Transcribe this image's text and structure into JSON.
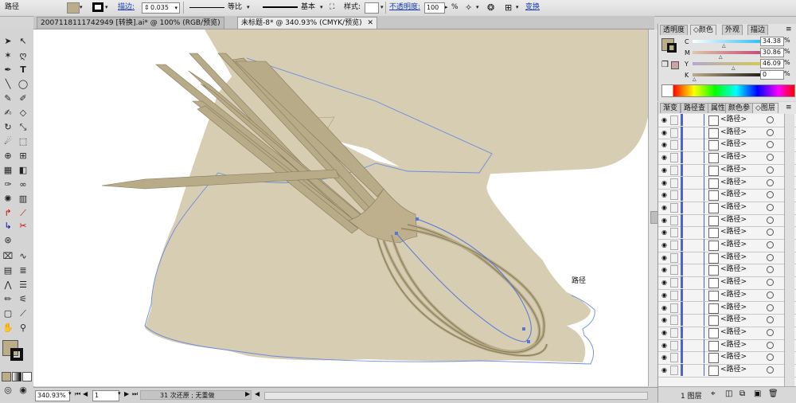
{
  "control_bar": {
    "object_type": "路径",
    "stroke_label": "描边:",
    "stroke_value": "0.035",
    "profile_uniform": "等比",
    "brush_basic": "基本",
    "style_label": "样式:",
    "opacity_label": "不透明度:",
    "opacity_value": "100",
    "percent": "%",
    "transform_label": "变换",
    "fill_color": "#b9ad8a"
  },
  "doc_tabs": [
    {
      "label": "20071181117429​49 [转换].ai* @ 100% (RGB/预览)"
    },
    {
      "label": "未标题-8* @ 340.93% (CMYK/预览)"
    }
  ],
  "canvas": {
    "path_label": "路径",
    "bg_color": "#d6cdb2",
    "whisk_color": "#b8ab88",
    "whisk_stroke": "#857a5a",
    "path_color": "#5577d9"
  },
  "status": {
    "zoom": "340.93%",
    "page": "1",
    "undo_text": "31 次还原 ; 无重做"
  },
  "color_panel": {
    "tabs": [
      "透明度",
      "颜色",
      "外观",
      "描边"
    ],
    "sliders": [
      {
        "label": "C",
        "value": "34.38"
      },
      {
        "label": "M",
        "value": "30.86"
      },
      {
        "label": "Y",
        "value": "46.09"
      },
      {
        "label": "K",
        "value": "0"
      }
    ]
  },
  "layers_panel": {
    "tabs": [
      "渐变",
      "路径查",
      "属性",
      "颜色参",
      "图层"
    ],
    "rows": [
      {
        "name": "<路径>"
      },
      {
        "name": "<路径>"
      },
      {
        "name": "<路径>"
      },
      {
        "name": "<路径>"
      },
      {
        "name": "<路径>"
      },
      {
        "name": "<路径>"
      },
      {
        "name": "<路径>"
      },
      {
        "name": "<路径>"
      },
      {
        "name": "<路径>"
      },
      {
        "name": "<路径>"
      },
      {
        "name": "<路径>"
      },
      {
        "name": "<路径>"
      },
      {
        "name": "<路径>"
      },
      {
        "name": "<路径>"
      },
      {
        "name": "<路径>"
      },
      {
        "name": "<路径>"
      },
      {
        "name": "<路径>"
      },
      {
        "name": "<路径>"
      },
      {
        "name": "<路径>"
      },
      {
        "name": "<路径>"
      },
      {
        "name": "<路径>"
      }
    ],
    "footer_label": "1 图层"
  }
}
